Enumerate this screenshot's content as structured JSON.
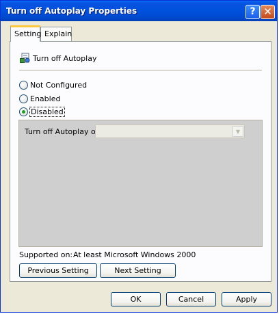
{
  "window": {
    "title": "Turn off Autoplay Properties",
    "help_glyph": "?",
    "close_glyph": "✕"
  },
  "tabs": [
    {
      "label": "Setting",
      "selected": true
    },
    {
      "label": "Explain",
      "selected": false
    }
  ],
  "policy": {
    "name": "Turn off Autoplay",
    "icon": "policy-settings-icon"
  },
  "radios": [
    {
      "label": "Not Configured",
      "checked": false
    },
    {
      "label": "Enabled",
      "checked": false
    },
    {
      "label": "Disabled",
      "checked": true
    }
  ],
  "options": {
    "label": "Turn off Autoplay on:",
    "select_value": "",
    "dropdown_glyph": "▼"
  },
  "supported": {
    "label": "Supported on:",
    "value": "At least Microsoft Windows 2000"
  },
  "nav_buttons": {
    "previous": "Previous Setting",
    "next": "Next Setting"
  },
  "dialog_buttons": {
    "ok": "OK",
    "cancel": "Cancel",
    "apply": "Apply"
  },
  "colors": {
    "titlebar": "#0051dd",
    "dialog_bg": "#ece9d8",
    "selected_tab_accent": "#ffc83c",
    "radio_check": "#21a121"
  }
}
